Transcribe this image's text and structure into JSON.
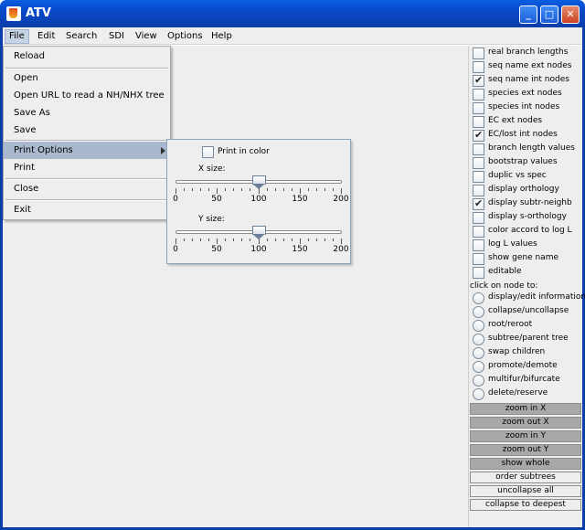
{
  "window": {
    "title": "ATV",
    "minimize_label": "_",
    "maximize_label": "□",
    "close_label": "✕"
  },
  "menubar": {
    "items": [
      "File",
      "Edit",
      "Search",
      "SDI",
      "View",
      "Options",
      "Help"
    ]
  },
  "file_menu": {
    "items": [
      "Reload",
      "Open",
      "Open URL to read a NH/NHX tree",
      "Save As",
      "Save",
      "Print Options",
      "Print",
      "Close",
      "Exit"
    ],
    "highlighted": "Print Options"
  },
  "print_options": {
    "print_in_color_label": "Print in color",
    "print_in_color_checked": false,
    "x_size_label": "X size:",
    "y_size_label": "Y size:",
    "x_size_value": 100,
    "y_size_value": 100,
    "slider_min": 0,
    "slider_max": 200,
    "tick_labels": [
      "0",
      "50",
      "100",
      "150",
      "200"
    ]
  },
  "right_panel": {
    "checkboxes": [
      {
        "label": "real branch lengths",
        "checked": false
      },
      {
        "label": "seq name ext nodes",
        "checked": false
      },
      {
        "label": "seq name int nodes",
        "checked": true
      },
      {
        "label": "species ext nodes",
        "checked": false
      },
      {
        "label": "species int nodes",
        "checked": false
      },
      {
        "label": "EC ext nodes",
        "checked": false
      },
      {
        "label": "EC/lost int nodes",
        "checked": true
      },
      {
        "label": "branch length values",
        "checked": false
      },
      {
        "label": "bootstrap values",
        "checked": false
      },
      {
        "label": "duplic vs spec",
        "checked": false
      },
      {
        "label": "display orthology",
        "checked": false
      },
      {
        "label": "display subtr-neighb",
        "checked": true
      },
      {
        "label": "display s-orthology",
        "checked": false
      },
      {
        "label": "color accord to log L",
        "checked": false
      },
      {
        "label": "log L values",
        "checked": false
      },
      {
        "label": "show gene name",
        "checked": false
      },
      {
        "label": "editable",
        "checked": false
      }
    ],
    "click_on_node_label": "click on node to:",
    "radios": [
      "display/edit information",
      "collapse/uncollapse",
      "root/reroot",
      "subtree/parent tree",
      "swap children",
      "promote/demote",
      "multifur/bifurcate",
      "delete/reserve"
    ],
    "buttons": [
      {
        "label": "zoom in X",
        "style": "dark"
      },
      {
        "label": "zoom out X",
        "style": "dark"
      },
      {
        "label": "zoom in Y",
        "style": "dark"
      },
      {
        "label": "zoom out Y",
        "style": "dark"
      },
      {
        "label": "show whole",
        "style": "dark"
      },
      {
        "label": "order subtrees",
        "style": "light"
      },
      {
        "label": "uncollapse all",
        "style": "light"
      },
      {
        "label": "collapse to deepest",
        "style": "light"
      }
    ]
  }
}
